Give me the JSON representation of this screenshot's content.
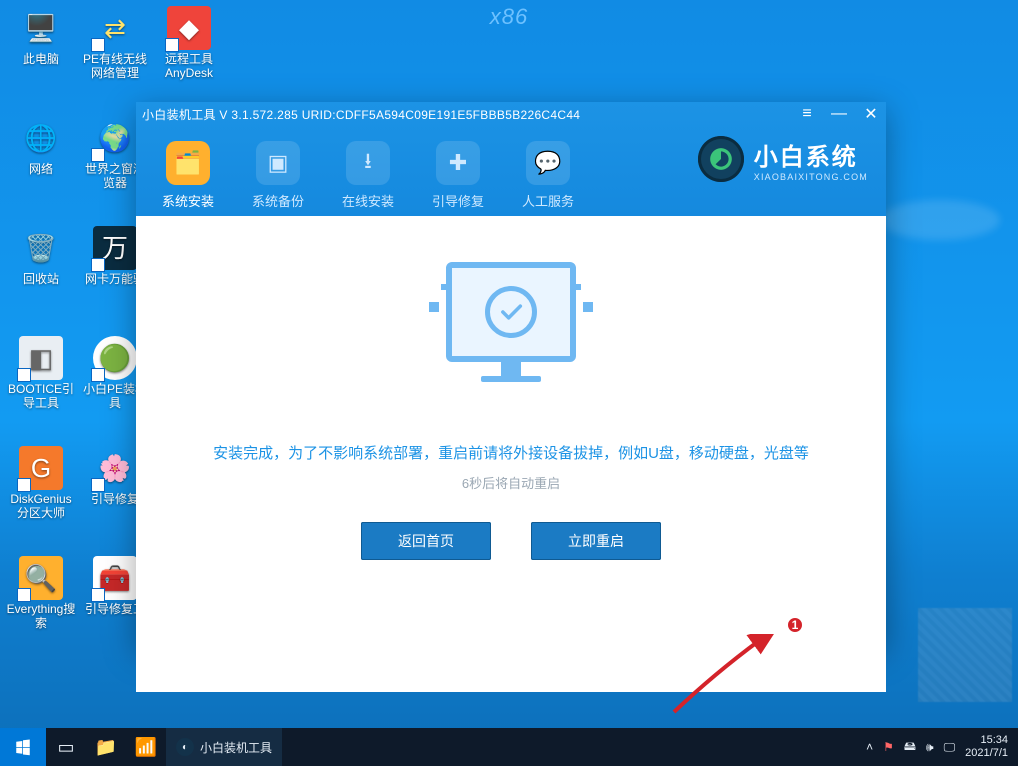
{
  "arch_label": "x86",
  "desktop_icons": {
    "this_pc": "此电脑",
    "pe_net": "PE有线无线网络管理",
    "anydesk": "远程工具AnyDesk",
    "network": "网络",
    "world_browser": "世界之窗浏览器",
    "recycle_bin": "回收站",
    "netcard": "网卡万能驱",
    "bootice": "BOOTICE引导工具",
    "xiaobai_pe": "小白PE装机具",
    "diskgenius": "DiskGenius分区大师",
    "boot_repair": "引导修复",
    "everything": "Everything搜索",
    "boot_repair2": "引导修复工"
  },
  "window": {
    "title": "小白装机工具 V 3.1.572.285 URID:CDFF5A594C09E191E5FBBB5B226C4C44",
    "tabs": {
      "install": "系统安装",
      "backup": "系统备份",
      "online": "在线安装",
      "bootfix": "引导修复",
      "service": "人工服务"
    },
    "brand_name": "小白系统",
    "brand_url": "XIAOBAIXITONG.COM",
    "message": "安装完成，为了不影响系统部署，重启前请将外接设备拔掉，例如U盘，移动硬盘，光盘等",
    "countdown": "6秒后将自动重启",
    "btn_back": "返回首页",
    "btn_reboot": "立即重启",
    "callout": "1"
  },
  "taskbar": {
    "app_label": "小白装机工具",
    "time": "15:34",
    "date": "2021/7/1"
  }
}
